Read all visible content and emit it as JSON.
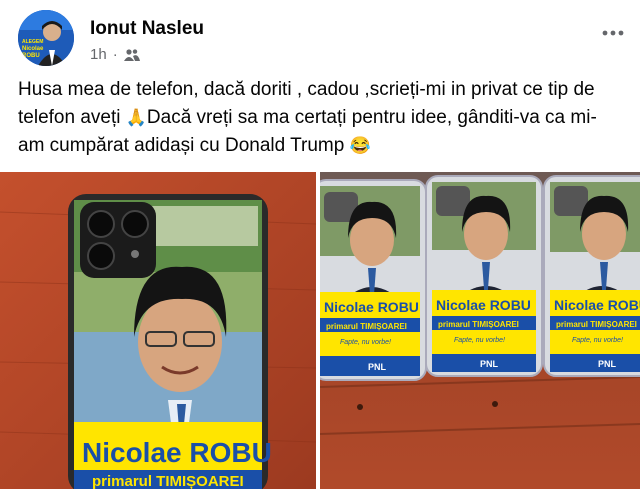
{
  "post": {
    "author": "Ionut Nasleu",
    "time": "1h",
    "separator": "·",
    "audience_icon": "friends-icon",
    "more_icon": "more-horizontal-icon",
    "text_line1": "Husa mea de telefon, dacă doriti , cadou ,scrieți-mi in privat ce tip de",
    "text_line2a": "telefon aveți ",
    "text_line2_emoji": "🙏",
    "text_line2b": "Dacă vreți sa ma certați pentru idee, gânditi-va ca mi-",
    "text_line3": "am cumpărat adidași cu Donald Trump ",
    "text_line3_emoji": "😂"
  },
  "avatar": {
    "line1": "ALEGEM",
    "line2": "Nicolae",
    "line3": "ROBU"
  },
  "phone_case": {
    "name": "Nicolae ROBU",
    "subtitle": "primarul TIMIȘOAREI",
    "slogan": "Fapte, nu vorbe!",
    "party": "PNL"
  },
  "colors": {
    "yellow": "#ffe500",
    "blue": "#1a4fa8",
    "wood": "#b8472a"
  }
}
